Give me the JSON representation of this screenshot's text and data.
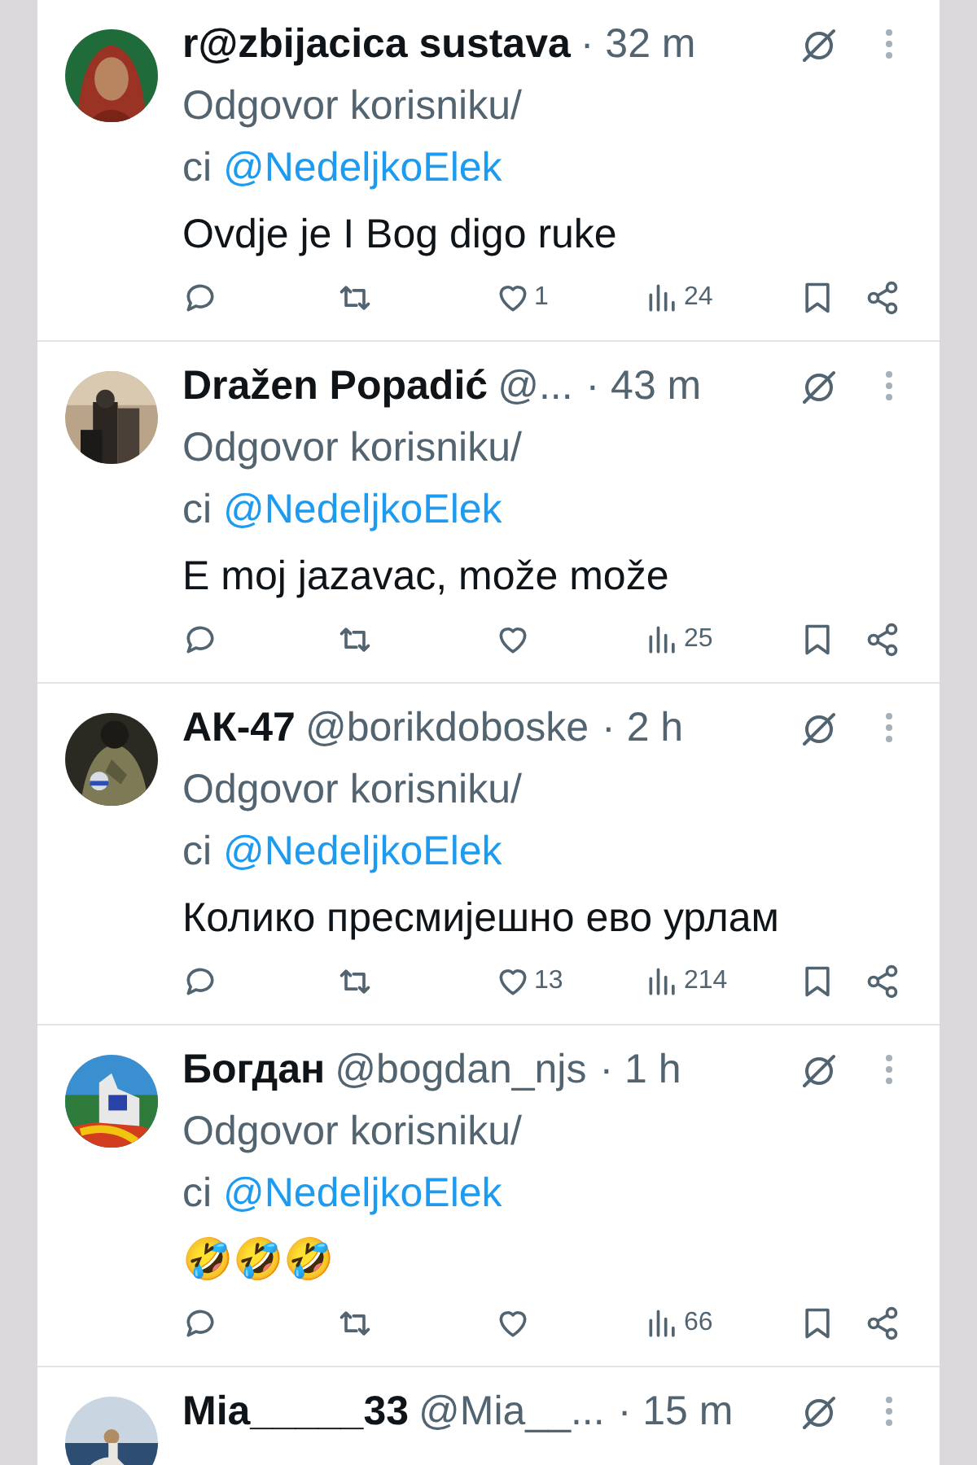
{
  "replies": [
    {
      "name": "r@zbijacica sustava",
      "time": "· 32 m",
      "reply_line": "Odgovor korisniku/",
      "reply_rest": "ci",
      "reply_to": "@NedeljkoElek",
      "text": "Ovdje je I Bog digo ruke",
      "likes": "1",
      "views": "24"
    },
    {
      "name": "Dražen Popadić",
      "handle": "@...",
      "time": "· 43 m",
      "reply_line": "Odgovor korisniku/",
      "reply_rest": "ci",
      "reply_to": "@NedeljkoElek",
      "text": "E moj jazavac, može može",
      "views": "25"
    },
    {
      "name": "АК-47",
      "handle": "@borikdoboske",
      "time": "· 2 h",
      "reply_line": "Odgovor korisniku/",
      "reply_rest": "ci",
      "reply_to": "@NedeljkoElek",
      "text": "Колико пресмијешно ево урлам",
      "likes": "13",
      "views": "214"
    },
    {
      "name": "Богдан",
      "handle": "@bogdan_njs",
      "time": "· 1 h",
      "reply_line": "Odgovor korisniku/",
      "reply_rest": "ci",
      "reply_to": "@NedeljkoElek",
      "text": "🤣🤣🤣",
      "views": "66"
    },
    {
      "name": "Mia_____33",
      "handle": "@Mia__...",
      "time": "· 15 m"
    }
  ]
}
